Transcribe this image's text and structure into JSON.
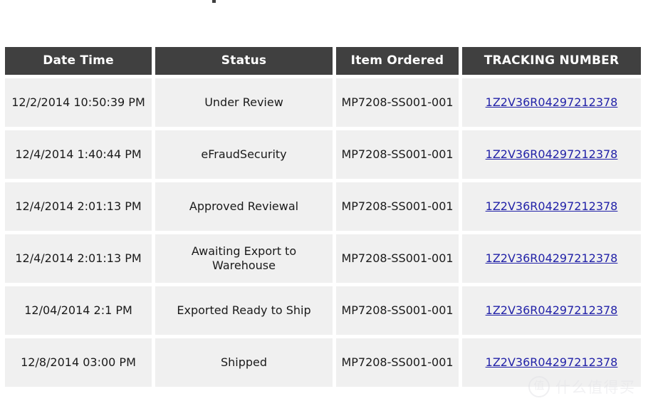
{
  "table": {
    "columns": [
      {
        "key": "date_time",
        "label": "Date Time"
      },
      {
        "key": "status",
        "label": "Status"
      },
      {
        "key": "item_ordered",
        "label": "Item Ordered"
      },
      {
        "key": "tracking_number",
        "label": "TRACKING NUMBER"
      }
    ],
    "rows": [
      {
        "date_time": "12/2/2014 10:50:39 PM",
        "status": "Under Review",
        "item_ordered": "MP7208-SS001-001",
        "tracking_number": "1Z2V36R04297212378"
      },
      {
        "date_time": "12/4/2014 1:40:44 PM",
        "status": "eFraudSecurity",
        "item_ordered": "MP7208-SS001-001",
        "tracking_number": "1Z2V36R04297212378"
      },
      {
        "date_time": "12/4/2014 2:01:13 PM",
        "status": "Approved Reviewal",
        "item_ordered": "MP7208-SS001-001",
        "tracking_number": "1Z2V36R04297212378"
      },
      {
        "date_time": "12/4/2014 2:01:13 PM",
        "status": "Awaiting Export to Warehouse",
        "item_ordered": "MP7208-SS001-001",
        "tracking_number": "1Z2V36R04297212378"
      },
      {
        "date_time": "12/04/2014 2:1 PM",
        "status": "Exported Ready to Ship",
        "item_ordered": "MP7208-SS001-001",
        "tracking_number": "1Z2V36R04297212378"
      },
      {
        "date_time": "12/8/2014 03:00 PM",
        "status": "Shipped",
        "item_ordered": "MP7208-SS001-001",
        "tracking_number": "1Z2V36R04297212378"
      }
    ]
  },
  "watermark": {
    "badge": "值",
    "text": "什么值得买"
  },
  "colors": {
    "header_background": "#404040",
    "header_text": "#ffffff",
    "cell_background": "#f0f0f0",
    "cell_text": "#1a1a1a",
    "link": "#2222a8",
    "page_background": "#ffffff"
  }
}
